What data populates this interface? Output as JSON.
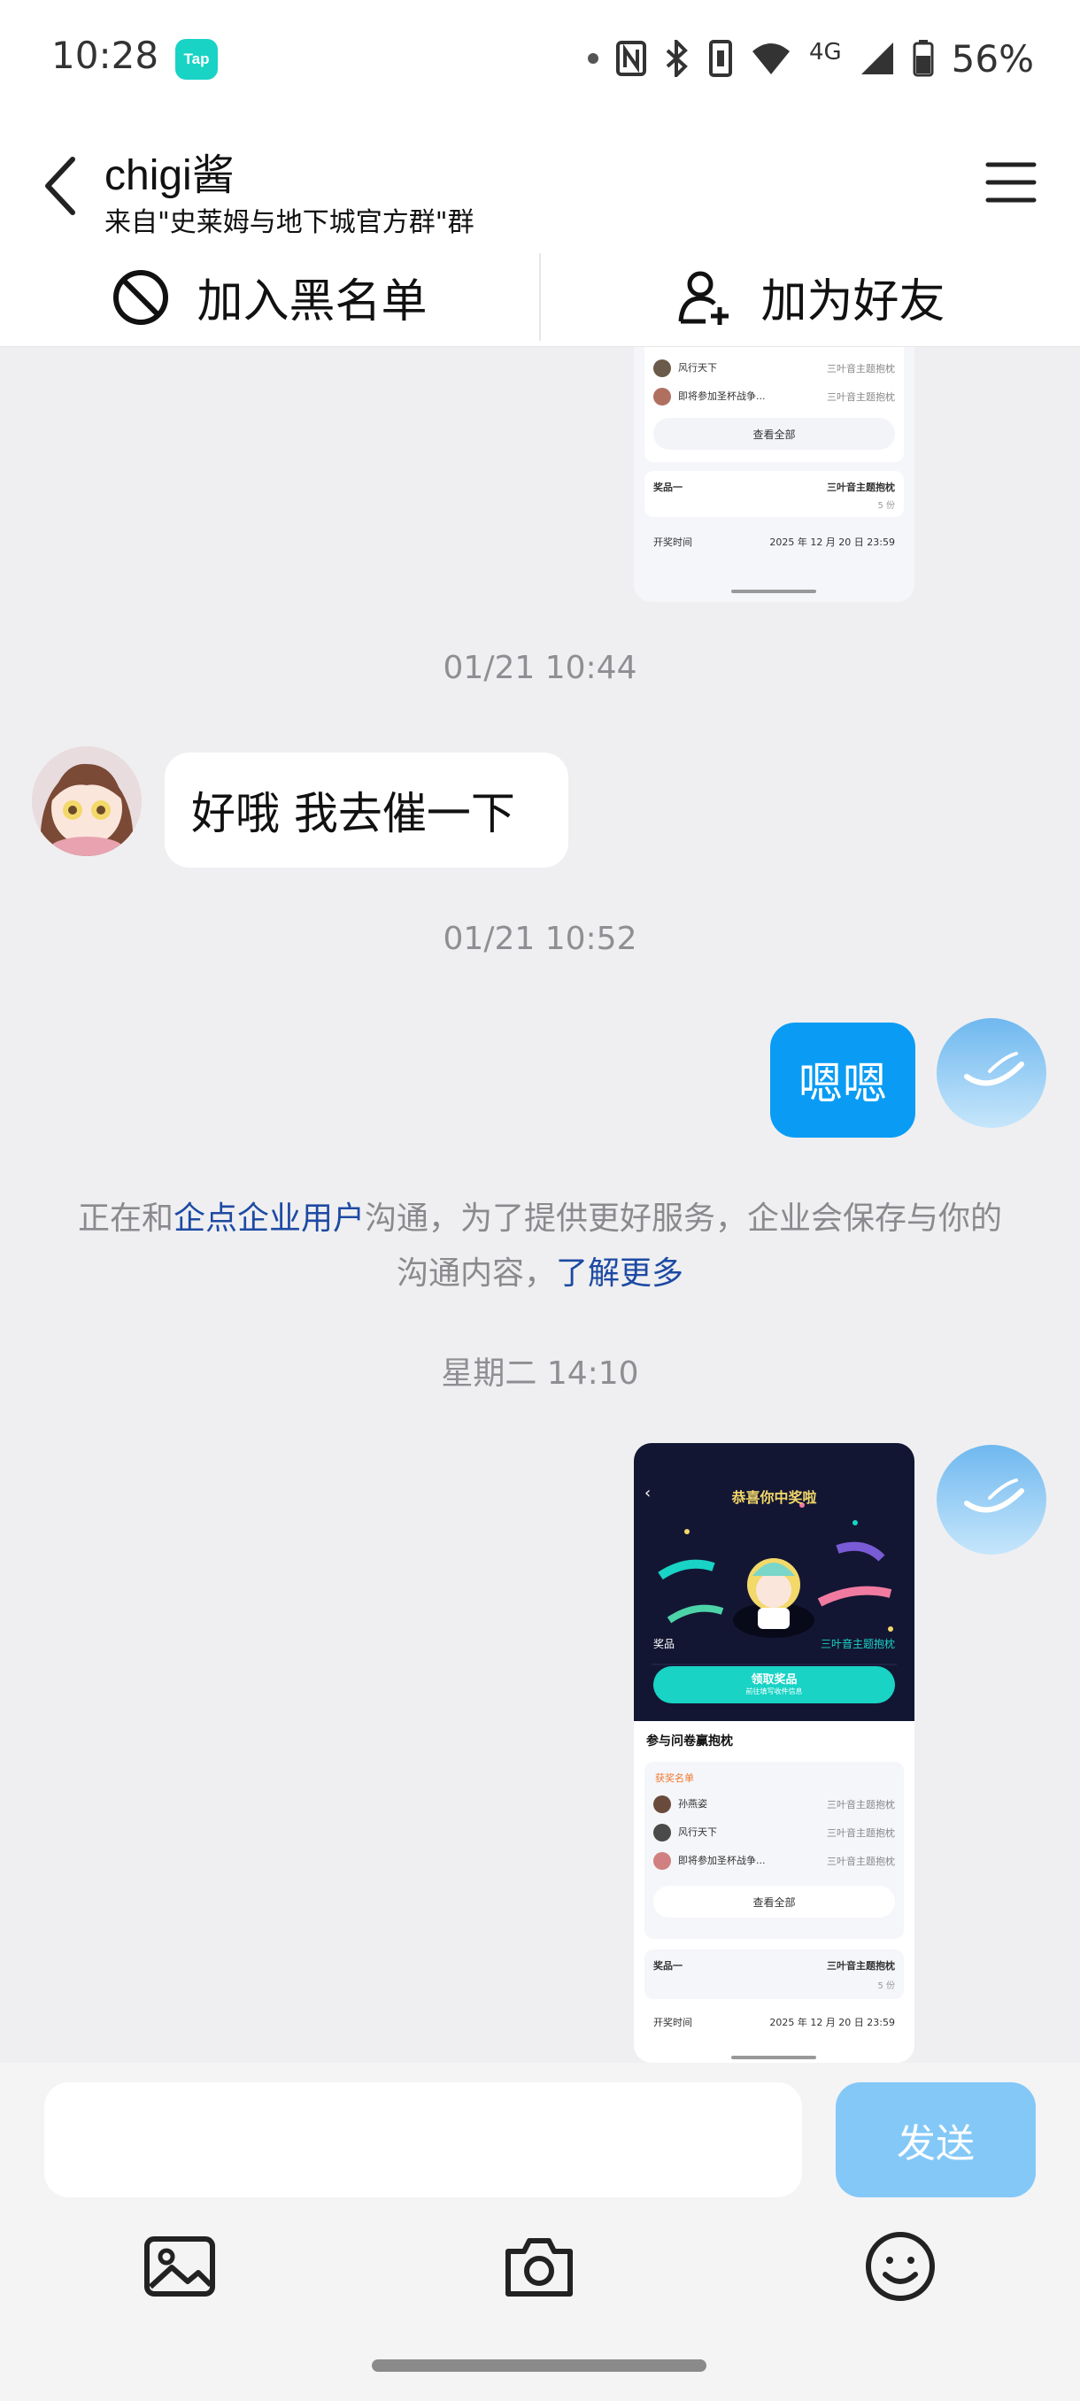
{
  "status_bar": {
    "time": "10:28",
    "app_badge": "Tap",
    "network": "4G",
    "battery": "56%"
  },
  "header": {
    "contact_name": "chigi酱",
    "contact_source": "来自\"史莱姆与地下城官方群\"群"
  },
  "actions": {
    "block_label": "加入黑名单",
    "add_friend_label": "加为好友"
  },
  "messages": {
    "ts1": "01/21 10:44",
    "incoming_text": "好哦  我去催一下",
    "ts2": "01/21 10:52",
    "outgoing_text": "嗯嗯",
    "notice_pre": "正在和",
    "notice_link": "企点企业用户",
    "notice_mid": "沟通，为了提供更好服务，企业会保存与你的沟通内容，",
    "notice_more": "了解更多",
    "ts3": "星期二 14:10"
  },
  "shot_top": {
    "row1_name": "风行天下",
    "row1_prize": "三叶音主题抱枕",
    "row2_name": "即将参加圣杯战争...",
    "row2_prize": "三叶音主题抱枕",
    "view_all": "查看全部",
    "prize_label": "奖品一",
    "prize_value": "三叶音主题抱枕",
    "prize_count": "5 份",
    "time_label": "开奖时间",
    "time_value": "2025 年 12 月 20 日 23:59"
  },
  "shot_bottom": {
    "congrats": "恭喜你中奖啦",
    "prize_label": "奖品",
    "prize_value": "三叶音主题抱枕",
    "claim_button": "领取奖品",
    "claim_sub": "前往填写收件信息",
    "section_title": "参与问卷赢抱枕",
    "winners_title": "获奖名单",
    "w1_name": "孙燕姿",
    "w1_prize": "三叶音主题抱枕",
    "w2_name": "风行天下",
    "w2_prize": "三叶音主题抱枕",
    "w3_name": "即将参加圣杯战争...",
    "w3_prize": "三叶音主题抱枕",
    "view_all": "查看全部",
    "p_label": "奖品一",
    "p_value": "三叶音主题抱枕",
    "p_count": "5 份",
    "t_label": "开奖时间",
    "t_value": "2025 年 12 月 20 日 23:59"
  },
  "composer": {
    "input_value": "",
    "send_label": "发送"
  },
  "colors": {
    "accent_blue": "#0a9cf5",
    "send_disabled": "#84c8f7",
    "link": "#1d4aa3",
    "teal": "#19d3c5"
  }
}
